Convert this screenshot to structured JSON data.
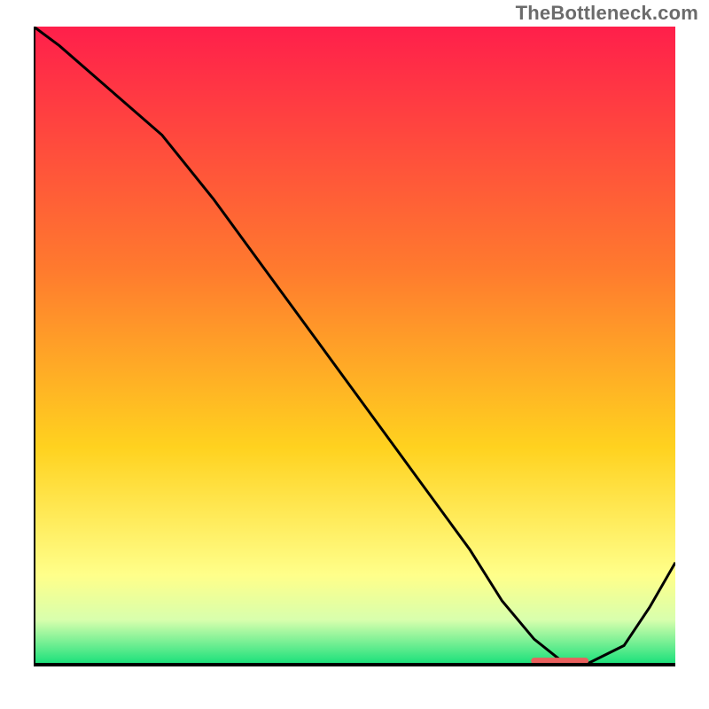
{
  "watermark": {
    "text": "TheBottleneck.com"
  },
  "colors": {
    "gradient_top": "#ff1f4b",
    "gradient_mid1": "#ff7a2e",
    "gradient_mid2": "#ffd21f",
    "gradient_low": "#ffff8a",
    "gradient_bottom": "#16e07a",
    "axis": "#000000",
    "curve": "#000000",
    "marker": "#e9605d"
  },
  "chart_data": {
    "type": "line",
    "title": "",
    "xlabel": "",
    "ylabel": "",
    "xlim": [
      0,
      100
    ],
    "ylim": [
      0,
      100
    ],
    "series": [
      {
        "name": "curve",
        "x": [
          0,
          4,
          12,
          20,
          28,
          36,
          44,
          52,
          60,
          68,
          73,
          78,
          83,
          86,
          92,
          96,
          100
        ],
        "y": [
          100,
          97,
          90,
          83,
          73,
          62,
          51,
          40,
          29,
          18,
          10,
          4,
          0,
          0,
          3,
          9,
          16
        ]
      }
    ],
    "marker_segment": {
      "x0": 78,
      "x1": 86,
      "y": 0.6
    },
    "grid": false,
    "legend": false
  }
}
